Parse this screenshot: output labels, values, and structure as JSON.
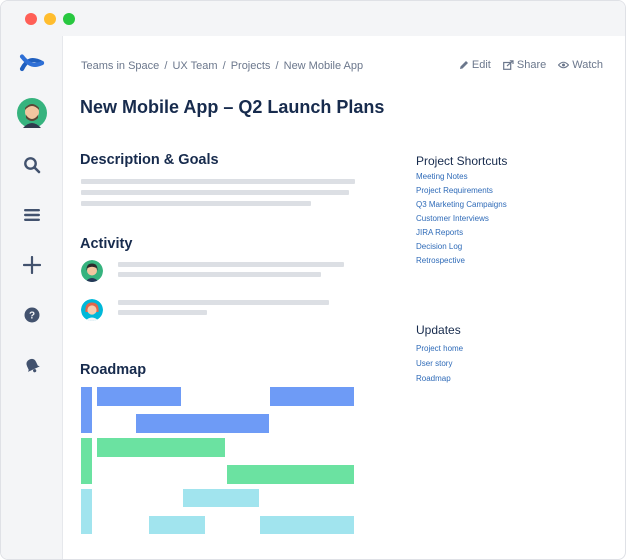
{
  "window": {
    "controls": [
      "close",
      "minimize",
      "maximize"
    ]
  },
  "sidebar": {
    "items": [
      {
        "icon": "confluence-logo-icon"
      },
      {
        "icon": "user-avatar-icon"
      },
      {
        "icon": "search-icon"
      },
      {
        "icon": "menu-icon"
      },
      {
        "icon": "plus-icon"
      },
      {
        "icon": "help-icon"
      },
      {
        "icon": "notification-bell-icon"
      }
    ]
  },
  "breadcrumb": {
    "items": [
      "Teams in Space",
      "UX Team",
      "Projects",
      "New Mobile App"
    ],
    "separator": "/"
  },
  "actions": {
    "edit": "Edit",
    "share": "Share",
    "watch": "Watch"
  },
  "page": {
    "title": "New Mobile App – Q2 Launch Plans"
  },
  "sections": {
    "description": "Description & Goals",
    "activity": "Activity",
    "roadmap": "Roadmap"
  },
  "shortcuts": {
    "title": "Project Shortcuts",
    "links": [
      "Meeting Notes",
      "Project Requirements",
      "Q3 Marketing Campaigns",
      "Customer Interviews",
      "JIRA Reports",
      "Decision Log",
      "Retrospective"
    ]
  },
  "updates": {
    "title": "Updates",
    "links": [
      "Project home",
      "User story",
      "Roadmap"
    ]
  },
  "colors": {
    "accent": "#2F6BB8",
    "roadmap_blue": "#6E9BF6",
    "roadmap_green": "#6BE2A1",
    "roadmap_cyan": "#A1E4EE"
  }
}
